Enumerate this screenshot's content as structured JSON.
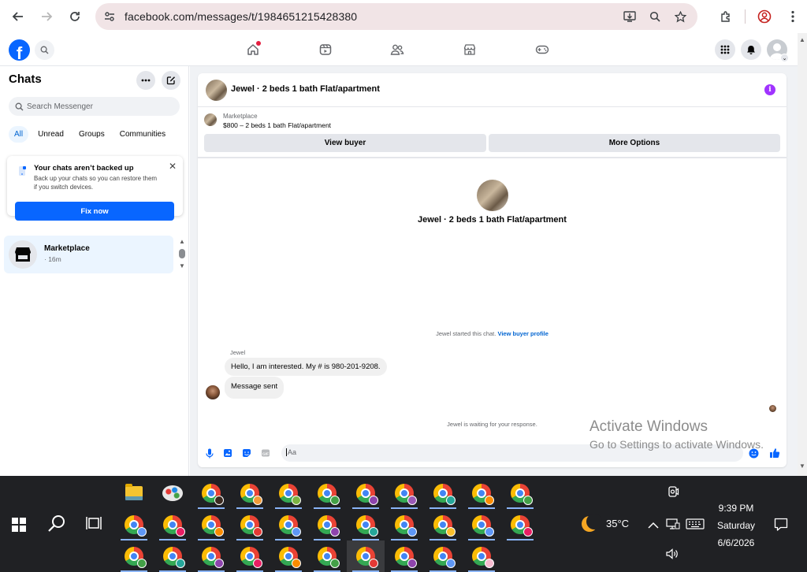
{
  "browser": {
    "url": "facebook.com/messages/t/1984651215428380"
  },
  "fb_nav": {
    "logo": "f"
  },
  "sidebar": {
    "title": "Chats",
    "search_placeholder": "Search Messenger",
    "filters": [
      "All",
      "Unread",
      "Groups",
      "Communities"
    ],
    "active_filter": "All",
    "backup": {
      "title": "Your chats aren’t backed up",
      "description": "Back up your chats so you can restore them if you switch devices.",
      "button": "Fix now"
    },
    "chat_item": {
      "name": "Marketplace",
      "time": "· 16m"
    }
  },
  "chat": {
    "header_title": "Jewel · 2 beds 1 bath Flat/apartment",
    "marketplace_label": "Marketplace",
    "listing": "$800 – 2 beds 1 bath Flat/apartment",
    "view_buyer": "View buyer",
    "more_options": "More Options",
    "center_name": "Jewel · 2 beds 1 bath Flat/apartment",
    "started_note": "Jewel started this chat.",
    "view_buyer_profile": "View buyer profile",
    "sender": "Jewel",
    "messages": [
      "Hello, I am interested. My # is 980-201-9208.",
      "Message sent"
    ],
    "waiting_note": "Jewel is waiting for your response.",
    "composer_placeholder": "Aa"
  },
  "watermark": {
    "title": "Activate Windows",
    "subtitle": "Go to Settings to activate Windows."
  },
  "taskbar": {
    "temperature": "35°C",
    "time": "9:39 PM",
    "day": "Saturday",
    "date": "6/6/2026"
  },
  "colors": {
    "fb_blue": "#0866ff",
    "chip_active_bg": "#ebf5ff",
    "info_purple": "#a033ff",
    "taskbar": "#202124"
  }
}
